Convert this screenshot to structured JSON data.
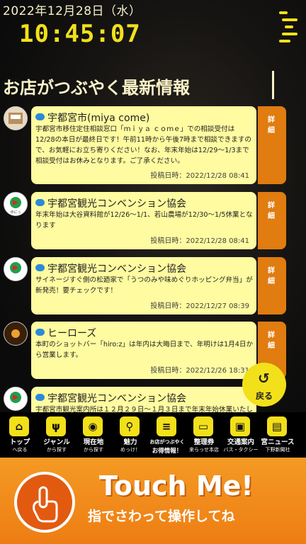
{
  "header": {
    "date": "2022年12月28日（水）",
    "time": "10:45:07"
  },
  "section_title": "お店がつぶやく最新情報",
  "posts": [
    {
      "name": "宇都宮市(miya come)",
      "body": "宇都宮市移住定住相談窓口「ｍｉｙａ ｃｏｍｅ」での相談受付は12/28の本日が最終日です！午前11時から午後7時まで相談できますので、お気軽にお立ち寄りください！なお、年末年始は12/29～1/3まで相談受付はお休みとなります。ご了承ください。",
      "time": "投稿日時：2022/12/28 08:41",
      "detail": "詳細"
    },
    {
      "name": "宇都宮観光コンベンション協会",
      "body": "年末年始は大谷資料館が12/26～1/1、若山農場が12/30～1/5休業となります",
      "time": "投稿日時：2022/12/28 08:41",
      "detail": "詳細"
    },
    {
      "name": "宇都宮観光コンベンション協会",
      "body": "サイネージすぐ側の松廼家で「うつのみや味めぐりホッピング弁当」が新発売！要チェックです！",
      "time": "投稿日時：2022/12/27 08:39",
      "detail": "詳細"
    },
    {
      "name": "ヒーローズ",
      "body": "本町のショットバー「hiro:z」は年内は大晦日まで、年明けは1月4日から営業します。",
      "time": "投稿日時：2022/12/26 18:31",
      "detail": "詳細"
    },
    {
      "name": "宇都宮観光コンベンション協会",
      "body": "宇都宮市観光案内所は１２月２９日～１月３日まで年末年始休業いたし",
      "time": "",
      "detail": ""
    }
  ],
  "back_button": {
    "label": "戻る",
    "icon": "back-arrow-icon"
  },
  "nav": [
    {
      "label": "トップ",
      "sub": "へ戻る",
      "icon": "home-icon",
      "glyph": "⌂"
    },
    {
      "label": "ジャンル",
      "sub": "から探す",
      "icon": "fork-knife-icon",
      "glyph": "ψ"
    },
    {
      "label": "現在地",
      "sub": "から探す",
      "icon": "map-pin-icon",
      "glyph": "◉"
    },
    {
      "label": "魅力",
      "sub": "めっけ！",
      "icon": "magnifier-icon",
      "glyph": "⚲"
    },
    {
      "label": "お店がつぶやく",
      "sub": "お得情報！",
      "icon": "chat-icon",
      "glyph": "≡"
    },
    {
      "label": "整理券",
      "sub": "来らっせ本店",
      "icon": "ticket-icon",
      "glyph": "▭"
    },
    {
      "label": "交通案内",
      "sub": "バス・タクシー",
      "icon": "bus-icon",
      "glyph": "▣"
    },
    {
      "label": "宮ニュース",
      "sub": "下野新聞社",
      "icon": "news-icon",
      "glyph": "▤"
    }
  ],
  "touch": {
    "title": "Touch Me!",
    "subtitle": "指でさわって操作してね",
    "icon": "touch-hand-icon"
  },
  "colors": {
    "accent_yellow": "#f2e01a",
    "card": "#fffba0",
    "detail": "#e07c10",
    "touch_orange": "#ee7d13"
  }
}
